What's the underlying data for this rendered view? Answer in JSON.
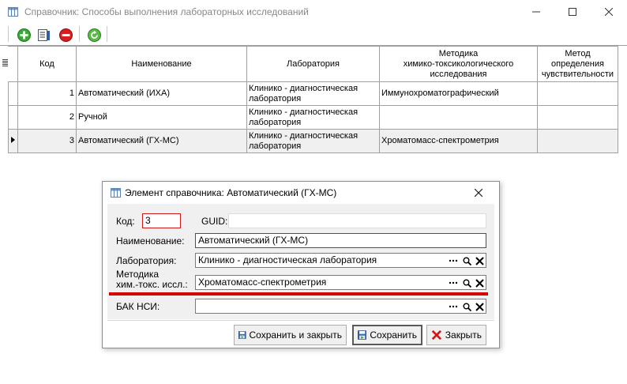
{
  "window": {
    "title": "Справочник: Способы выполнения лабораторных исследований"
  },
  "toolbar": {
    "add_icon": "add-icon",
    "edit_icon": "edit-icon",
    "delete_icon": "delete-icon",
    "refresh_icon": "refresh-icon"
  },
  "grid": {
    "columns": [
      {
        "label": "Код"
      },
      {
        "label": "Наименование"
      },
      {
        "label": "Лаборатория"
      },
      {
        "label": "Методика\nхимико-токсикологического\nисследования"
      },
      {
        "label": "Метод\nопределения\nчувствительности"
      }
    ],
    "rows": [
      {
        "code": "1",
        "name": "Автоматический (ИХА)",
        "lab": "Клинико - диагностическая лаборатория",
        "method": "Иммунохроматографический",
        "sens": ""
      },
      {
        "code": "2",
        "name": "Ручной",
        "lab": "Клинико - диагностическая лаборатория",
        "method": "",
        "sens": ""
      },
      {
        "code": "3",
        "name": "Автоматический (ГХ-МС)",
        "lab": "Клинико - диагностическая лаборатория",
        "method": "Хроматомасс-спектрометрия",
        "sens": ""
      }
    ],
    "selected_row": 2
  },
  "dialog": {
    "title": "Элемент справочника: Автоматический (ГХ-МС)",
    "code_label": "Код:",
    "code_value": "3",
    "guid_label": "GUID:",
    "guid_value": "",
    "name_label": "Наименование:",
    "name_value": "Автоматический (ГХ-МС)",
    "lab_label": "Лаборатория:",
    "lab_value": "Клинико - диагностическая лаборатория",
    "method_label_1": "Методика",
    "method_label_2": "хим.-токс. иссл.:",
    "method_value": "Хроматомасс-спектрометрия",
    "bak_label": "БАК НСИ:",
    "bak_value": "",
    "btn_save_close": "Сохранить и закрыть",
    "btn_save": "Сохранить",
    "btn_close": "Закрыть"
  },
  "colors": {
    "accent_red": "#d01a1a",
    "highlight_bar": "#d40000"
  }
}
